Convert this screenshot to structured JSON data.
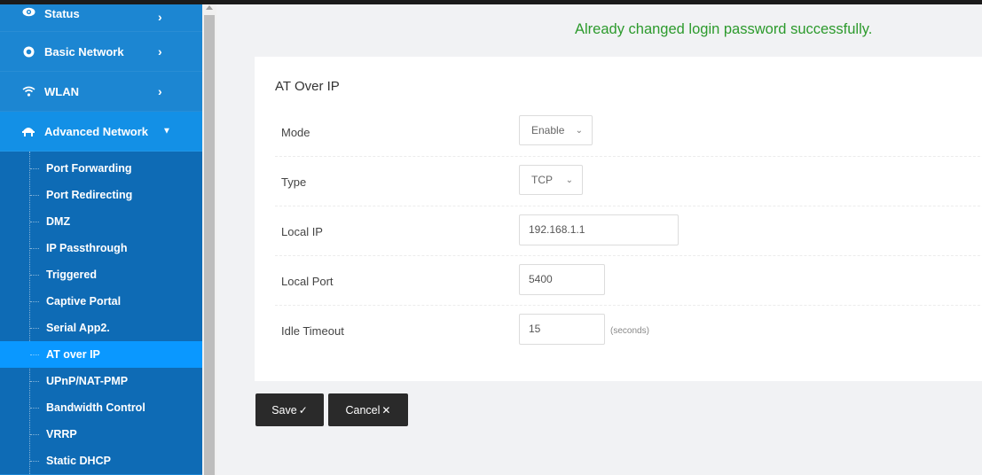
{
  "sidebar": {
    "items": [
      {
        "label": "Status",
        "icon": "eye-icon"
      },
      {
        "label": "Basic Network",
        "icon": "globe-icon"
      },
      {
        "label": "WLAN",
        "icon": "wifi-icon"
      },
      {
        "label": "Advanced Network",
        "icon": "network-icon"
      }
    ],
    "submenu": [
      "Port Forwarding",
      "Port Redirecting",
      "DMZ",
      "IP Passthrough",
      "Triggered",
      "Captive Portal",
      "Serial App2.",
      "AT over IP",
      "UPnP/NAT-PMP",
      "Bandwidth Control",
      "VRRP",
      "Static DHCP"
    ],
    "active_submenu": "AT over IP"
  },
  "message": "Already changed login password successfully.",
  "form": {
    "title": "AT Over IP",
    "mode": {
      "label": "Mode",
      "value": "Enable"
    },
    "type": {
      "label": "Type",
      "value": "TCP"
    },
    "local_ip": {
      "label": "Local IP",
      "value": "192.168.1.1"
    },
    "local_port": {
      "label": "Local Port",
      "value": "5400"
    },
    "idle_timeout": {
      "label": "Idle Timeout",
      "value": "15",
      "unit": "(seconds)"
    }
  },
  "buttons": {
    "save": "Save",
    "cancel": "Cancel"
  },
  "colors": {
    "sidebar": "#1c86d2",
    "submenu": "#0e6bb5",
    "active": "#0a98ff",
    "success": "#2c9a2c",
    "button": "#2a2a2a"
  }
}
